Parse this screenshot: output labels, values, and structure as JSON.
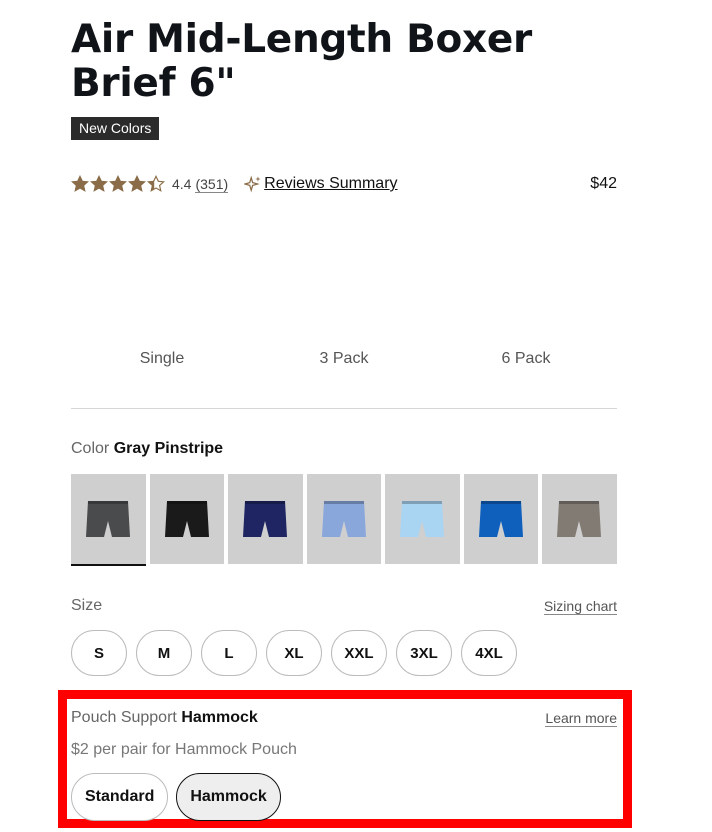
{
  "product": {
    "title": "Air Mid-Length Boxer Brief 6\"",
    "badge": "New Colors",
    "rating": "4.4",
    "rating_count": "(351)",
    "rating_value": 4.4,
    "reviews_link": "Reviews Summary",
    "price": "$42"
  },
  "pack_tabs": [
    {
      "label": "Single",
      "active": true
    },
    {
      "label": "3 Pack",
      "active": false
    },
    {
      "label": "6 Pack",
      "active": false
    }
  ],
  "color": {
    "label": "Color",
    "selected": "Gray Pinstripe",
    "swatches": [
      {
        "name": "gray-pinstripe",
        "color": "#4a4b4d",
        "selected": true
      },
      {
        "name": "black",
        "color": "#1a1a1a",
        "selected": false
      },
      {
        "name": "navy",
        "color": "#1f2563",
        "selected": false
      },
      {
        "name": "blue-pattern",
        "color": "#8aa7dc",
        "selected": false
      },
      {
        "name": "light-blue",
        "color": "#a9d4f2",
        "selected": false
      },
      {
        "name": "royal-blue",
        "color": "#0f5fbd",
        "selected": false
      },
      {
        "name": "taupe",
        "color": "#827b74",
        "selected": false
      }
    ]
  },
  "size": {
    "label": "Size",
    "sizing_chart": "Sizing chart",
    "options": [
      "S",
      "M",
      "L",
      "XL",
      "XXL",
      "3XL",
      "4XL"
    ]
  },
  "pouch": {
    "label": "Pouch Support",
    "selected": "Hammock",
    "learn_more": "Learn more",
    "price_note": "$2 per pair for Hammock Pouch",
    "options": [
      {
        "label": "Standard",
        "active": false
      },
      {
        "label": "Hammock",
        "active": true
      }
    ]
  },
  "colors": {
    "star": "#8a6d48",
    "highlight": "#ff0000"
  }
}
